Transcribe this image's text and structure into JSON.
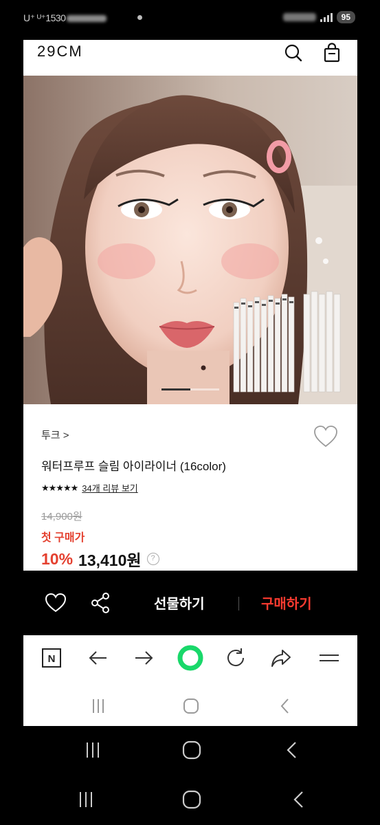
{
  "status_bar": {
    "carrier": "U⁺ ᵁ⁺1530",
    "battery": "95"
  },
  "header": {
    "logo": "29CM"
  },
  "product": {
    "brand": "투크 >",
    "name": "워터프루프 슬림 아이라이너 (16color)",
    "stars": "★★★★★",
    "review_link": "34개 리뷰 보기",
    "original_price": "14,900원",
    "first_purchase_label": "첫 구매가",
    "discount": "10%",
    "price": "13,410원",
    "info_icon": "?"
  },
  "image_indicator": {
    "count": 2,
    "active": 0
  },
  "actions": {
    "gift": "선물하기",
    "buy": "구매하기"
  },
  "browser_toolbar": {
    "naver_label": "N"
  },
  "colors": {
    "accent_red": "#e4402f",
    "buy_red": "#ff3b30",
    "green": "#19d86a"
  },
  "icons": [
    "search-icon",
    "shopping-bag-icon",
    "heart-icon",
    "share-icon",
    "back-arrow-icon",
    "forward-arrow-icon",
    "green-circle-icon",
    "refresh-icon",
    "share-arrow-icon",
    "menu-icon",
    "recent-apps-icon",
    "home-icon",
    "back-icon"
  ]
}
